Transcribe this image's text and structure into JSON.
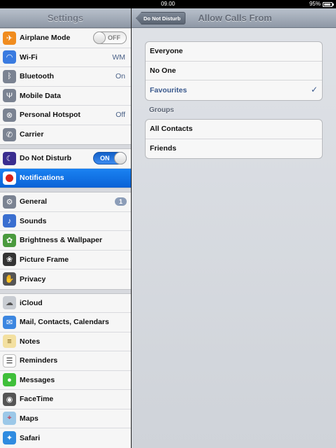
{
  "status_bar": {
    "time": "09.00",
    "battery": "95%"
  },
  "left_pane": {
    "title": "Settings",
    "groups": [
      {
        "items": [
          {
            "label": "Airplane Mode",
            "icon": "airplane-icon",
            "toggle": "OFF"
          },
          {
            "label": "Wi-Fi",
            "icon": "wifi-icon",
            "value": "WM"
          },
          {
            "label": "Bluetooth",
            "icon": "bluetooth-icon",
            "value": "On"
          },
          {
            "label": "Mobile Data",
            "icon": "antenna-icon"
          },
          {
            "label": "Personal Hotspot",
            "icon": "hotspot-icon",
            "value": "Off"
          },
          {
            "label": "Carrier",
            "icon": "phone-icon"
          }
        ]
      },
      {
        "items": [
          {
            "label": "Do Not Disturb",
            "icon": "moon-icon",
            "toggle": "ON"
          },
          {
            "label": "Notifications",
            "icon": "notifications-icon",
            "selected": true
          }
        ]
      },
      {
        "items": [
          {
            "label": "General",
            "icon": "gear-icon",
            "badge": "1"
          },
          {
            "label": "Sounds",
            "icon": "speaker-icon"
          },
          {
            "label": "Brightness & Wallpaper",
            "icon": "flower-icon"
          },
          {
            "label": "Picture Frame",
            "icon": "picture-frame-icon"
          },
          {
            "label": "Privacy",
            "icon": "hand-icon"
          }
        ]
      },
      {
        "items": [
          {
            "label": "iCloud",
            "icon": "cloud-icon"
          },
          {
            "label": "Mail, Contacts, Calendars",
            "icon": "mail-icon"
          },
          {
            "label": "Notes",
            "icon": "notes-icon"
          },
          {
            "label": "Reminders",
            "icon": "reminders-icon"
          },
          {
            "label": "Messages",
            "icon": "messages-icon"
          },
          {
            "label": "FaceTime",
            "icon": "facetime-icon"
          },
          {
            "label": "Maps",
            "icon": "maps-icon"
          },
          {
            "label": "Safari",
            "icon": "safari-icon"
          }
        ]
      }
    ]
  },
  "right_pane": {
    "back_label": "Do Not Disturb",
    "title": "Allow Calls From",
    "options": [
      {
        "label": "Everyone"
      },
      {
        "label": "No One"
      },
      {
        "label": "Favourites",
        "checked": true
      }
    ],
    "groups_header": "Groups",
    "groups": [
      {
        "label": "All Contacts"
      },
      {
        "label": "Friends"
      }
    ]
  },
  "colors": {
    "accent": "#0a62d6",
    "value_text": "#4a6187",
    "checkmark": "#3b5a8e"
  }
}
